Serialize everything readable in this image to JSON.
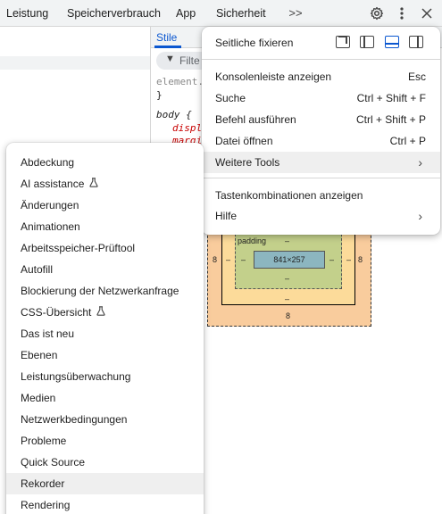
{
  "tabs": [
    "Leistung",
    "Speicherverbrauch",
    "App",
    "Sicherheit"
  ],
  "overflow_icon": ">>",
  "toolbar_icons": {
    "settings": "gear-icon",
    "more": "more-vert-icon",
    "close": "close-icon"
  },
  "styles_panel": {
    "tab_label": "Stile",
    "filter_placeholder": "Filte",
    "code": {
      "line1": "element.",
      "line2": "}",
      "line3": "body {",
      "line4": "displ",
      "line5": "margi"
    }
  },
  "box_model": {
    "margin_left": "8",
    "margin_right": "8",
    "margin_bottom": "8",
    "border_left": "–",
    "border_right": "–",
    "padding_label": "padding",
    "padding_top": "–",
    "padding_left": "–",
    "padding_right": "–",
    "padding_bottom": "–",
    "content_size": "841×257",
    "border_bottom": "–"
  },
  "main_menu": {
    "dock_label": "Seitliche fixieren",
    "dock_options": [
      "undock-icon",
      "dock-left-icon",
      "dock-bottom-icon",
      "dock-right-icon"
    ],
    "dock_active": "dock-bottom-icon",
    "items_group1": [
      {
        "label": "Konsolenleiste anzeigen",
        "shortcut": "Esc"
      },
      {
        "label": "Suche",
        "shortcut": "Ctrl + Shift + F"
      },
      {
        "label": "Befehl ausführen",
        "shortcut": "Ctrl + Shift + P"
      },
      {
        "label": "Datei öffnen",
        "shortcut": "Ctrl + P"
      },
      {
        "label": "Weitere Tools",
        "arrow": "›"
      }
    ],
    "items_group2": [
      {
        "label": "Tastenkombinationen anzeigen"
      },
      {
        "label": "Hilfe",
        "arrow": "›"
      }
    ]
  },
  "sub_menu": {
    "items": [
      {
        "label": "Abdeckung"
      },
      {
        "label": "AI assistance",
        "experimental": true
      },
      {
        "label": "Änderungen"
      },
      {
        "label": "Animationen"
      },
      {
        "label": "Arbeitsspeicher-Prüftool"
      },
      {
        "label": "Autofill"
      },
      {
        "label": "Blockierung der Netzwerkanfrage"
      },
      {
        "label": "CSS-Übersicht",
        "experimental": true
      },
      {
        "label": "Das ist neu"
      },
      {
        "label": "Ebenen"
      },
      {
        "label": "Leistungsüberwachung"
      },
      {
        "label": "Medien"
      },
      {
        "label": "Netzwerkbedingungen"
      },
      {
        "label": "Probleme"
      },
      {
        "label": "Quick Source"
      },
      {
        "label": "Rekorder"
      },
      {
        "label": "Rendering"
      }
    ],
    "highlighted": "Rekorder"
  },
  "colors": {
    "accent": "#0b57d0",
    "highlight": "#efefef"
  }
}
